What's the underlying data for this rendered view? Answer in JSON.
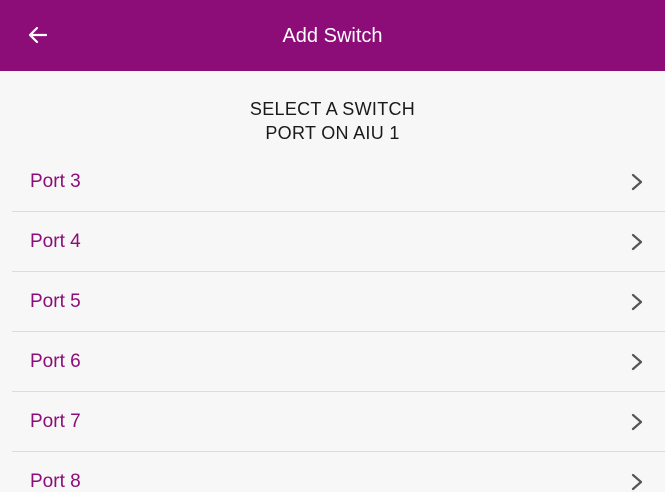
{
  "header": {
    "title": "Add Switch",
    "back_icon": "arrow-left-icon",
    "background_color": "#8c0d78"
  },
  "section": {
    "title_line1": "SELECT A SWITCH",
    "title_line2": "PORT ON AIU 1"
  },
  "ports": [
    {
      "label": "Port 3"
    },
    {
      "label": "Port 4"
    },
    {
      "label": "Port 5"
    },
    {
      "label": "Port 6"
    },
    {
      "label": "Port 7"
    },
    {
      "label": "Port 8"
    }
  ],
  "colors": {
    "accent": "#8c0d78",
    "chevron": "#555555"
  },
  "row_icon": "chevron-right-icon"
}
